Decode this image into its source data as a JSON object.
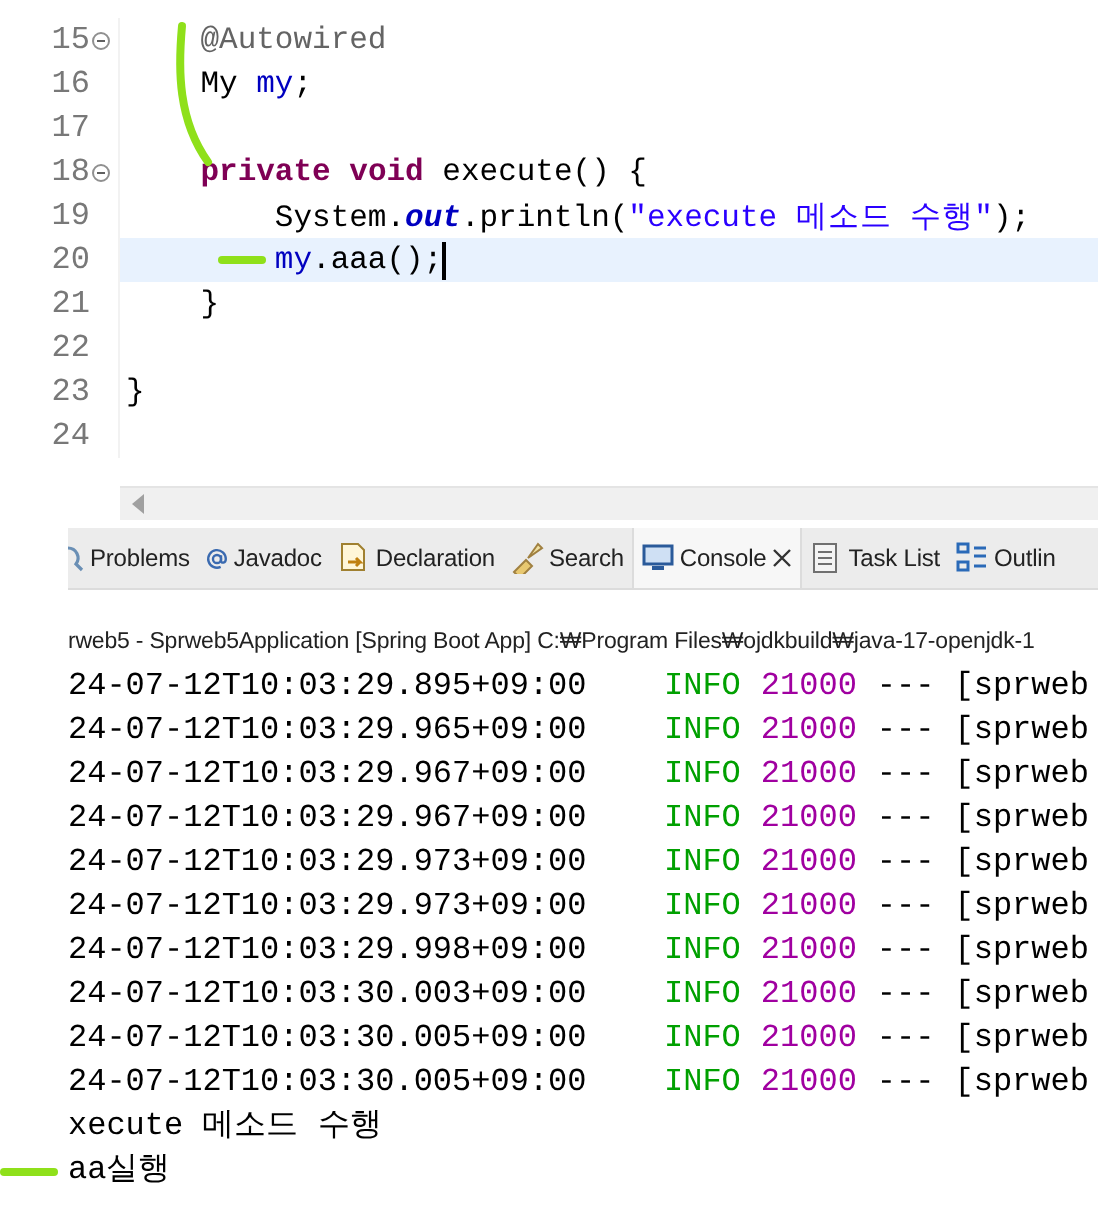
{
  "editor": {
    "lines": [
      {
        "number": "15",
        "fold": true,
        "current": false,
        "tokens": [
          {
            "kind": "annotation",
            "text": "    @Autowired"
          }
        ]
      },
      {
        "number": "16",
        "fold": false,
        "current": false,
        "tokens": [
          {
            "kind": "plain",
            "text": "    My "
          },
          {
            "kind": "field",
            "text": "my"
          },
          {
            "kind": "plain",
            "text": ";"
          }
        ]
      },
      {
        "number": "17",
        "fold": false,
        "current": false
      },
      {
        "number": "18",
        "fold": true,
        "current": false,
        "tokens": [
          {
            "kind": "keyword",
            "text": "    private"
          },
          {
            "kind": "keyword",
            "text": " void"
          },
          {
            "kind": "plain",
            "text": " execute() {"
          }
        ]
      },
      {
        "number": "19",
        "fold": false,
        "current": false,
        "tokens": [
          {
            "kind": "plain",
            "text": "        System."
          },
          {
            "kind": "static",
            "text": "out"
          },
          {
            "kind": "plain",
            "text": ".println("
          },
          {
            "kind": "string",
            "text": "\"execute 메소드 수행\""
          },
          {
            "kind": "plain",
            "text": ");"
          }
        ]
      },
      {
        "number": "20",
        "fold": false,
        "current": true,
        "tokens": [
          {
            "kind": "field",
            "text": "        my"
          },
          {
            "kind": "plain",
            "text": ".aaa();"
          }
        ]
      },
      {
        "number": "21",
        "fold": false,
        "current": false,
        "tokens": [
          {
            "kind": "plain",
            "text": "    }"
          }
        ]
      },
      {
        "number": "22",
        "fold": false,
        "current": false
      },
      {
        "number": "23",
        "fold": false,
        "current": false,
        "tokens": [
          {
            "kind": "plain",
            "text": "}"
          }
        ]
      },
      {
        "number": "24",
        "fold": false,
        "current": false
      }
    ]
  },
  "tabs": [
    {
      "label": "Problems",
      "selected": false
    },
    {
      "label": "Javadoc",
      "selected": false
    },
    {
      "label": "Declaration",
      "selected": false
    },
    {
      "label": "Search",
      "selected": false
    },
    {
      "label": "Console",
      "selected": true
    },
    {
      "label": "Task List",
      "selected": false
    },
    {
      "label": "Outlin",
      "selected": false
    }
  ],
  "console": {
    "header": "rweb5 - Sprweb5Application [Spring Boot App] C:₩Program Files₩ojdkbuild₩java-17-openjdk-1",
    "log": [
      {
        "timestamp": "24-07-12T10:03:29.895+09:00",
        "level": "INFO",
        "pid": "21000",
        "separator": "---",
        "thread": "[sprweb"
      },
      {
        "timestamp": "24-07-12T10:03:29.965+09:00",
        "level": "INFO",
        "pid": "21000",
        "separator": "---",
        "thread": "[sprweb"
      },
      {
        "timestamp": "24-07-12T10:03:29.967+09:00",
        "level": "INFO",
        "pid": "21000",
        "separator": "---",
        "thread": "[sprweb"
      },
      {
        "timestamp": "24-07-12T10:03:29.967+09:00",
        "level": "INFO",
        "pid": "21000",
        "separator": "---",
        "thread": "[sprweb"
      },
      {
        "timestamp": "24-07-12T10:03:29.973+09:00",
        "level": "INFO",
        "pid": "21000",
        "separator": "---",
        "thread": "[sprweb"
      },
      {
        "timestamp": "24-07-12T10:03:29.973+09:00",
        "level": "INFO",
        "pid": "21000",
        "separator": "---",
        "thread": "[sprweb"
      },
      {
        "timestamp": "24-07-12T10:03:29.998+09:00",
        "level": "INFO",
        "pid": "21000",
        "separator": "---",
        "thread": "[sprweb"
      },
      {
        "timestamp": "24-07-12T10:03:30.003+09:00",
        "level": "INFO",
        "pid": "21000",
        "separator": "---",
        "thread": "[sprweb"
      },
      {
        "timestamp": "24-07-12T10:03:30.005+09:00",
        "level": "INFO",
        "pid": "21000",
        "separator": "---",
        "thread": "[sprweb"
      },
      {
        "timestamp": "24-07-12T10:03:30.005+09:00",
        "level": "INFO",
        "pid": "21000",
        "separator": "---",
        "thread": "[sprweb"
      }
    ],
    "output": [
      "xecute 메소드 수행",
      "aa실행"
    ]
  }
}
